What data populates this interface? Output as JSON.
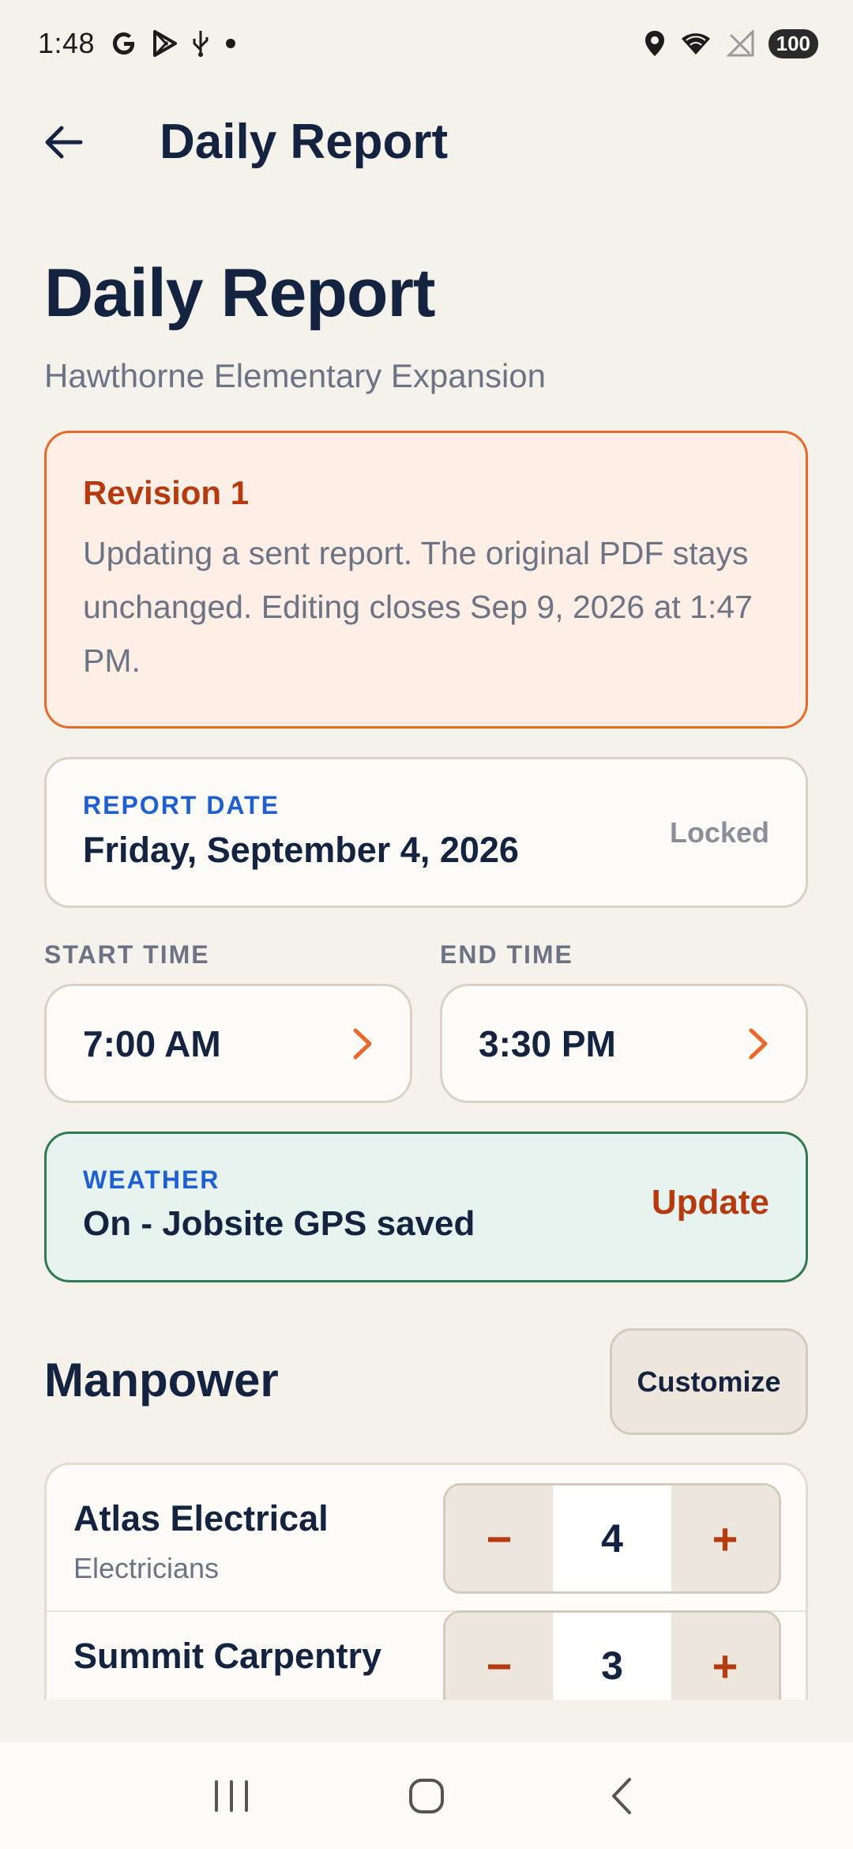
{
  "status_bar": {
    "time": "1:48",
    "battery": "100"
  },
  "app_bar": {
    "title": "Daily Report"
  },
  "header": {
    "title": "Daily Report",
    "subtitle": "Hawthorne Elementary Expansion"
  },
  "revision": {
    "title": "Revision 1",
    "body": "Updating a sent report. The original PDF stays unchanged. Editing closes Sep 9, 2026 at 1:47 PM."
  },
  "report_date": {
    "label": "REPORT DATE",
    "value": "Friday, September 4, 2026",
    "status": "Locked"
  },
  "times": {
    "start_label": "START TIME",
    "start_value": "7:00 AM",
    "end_label": "END TIME",
    "end_value": "3:30 PM"
  },
  "weather": {
    "label": "WEATHER",
    "value": "On - Jobsite GPS saved",
    "action": "Update"
  },
  "manpower": {
    "title": "Manpower",
    "customize_label": "Customize",
    "rows": [
      {
        "name": "Atlas Electrical",
        "role": "Electricians",
        "count": "4"
      },
      {
        "name": "Summit Carpentry",
        "role": "",
        "count": "3"
      }
    ],
    "minus": "−",
    "plus": "+"
  },
  "colors": {
    "accent_orange": "#e86a2a",
    "accent_red": "#b53a10",
    "label_blue": "#1f5fd0",
    "navy": "#14233f",
    "weather_green": "#2f7a52"
  }
}
